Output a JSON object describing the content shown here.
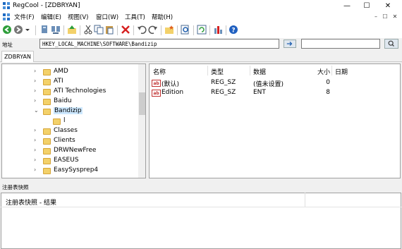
{
  "window": {
    "title": "RegCool - [ZDBRYAN]",
    "minimize": "—",
    "maximize": "☐",
    "close": "✕"
  },
  "menu": {
    "items": [
      "文件(F)",
      "编辑(E)",
      "视图(V)",
      "窗口(W)",
      "工具(T)",
      "帮助(H)"
    ],
    "mdi": [
      "–",
      "☐",
      "✕"
    ]
  },
  "toolbar": {
    "icons": [
      "back-icon",
      "forward-icon",
      "dropdown-icon",
      "computer-icon",
      "network-icon",
      "up-icon",
      "cut-icon",
      "copy-icon",
      "paste-icon",
      "delete-icon",
      "undo-icon",
      "redo-icon",
      "favorites-icon",
      "find-icon",
      "refresh-icon",
      "options-icon",
      "help-icon"
    ]
  },
  "address": {
    "label": "地址",
    "value": "HKEY_LOCAL_MACHINE\\SOFTWARE\\Bandizip",
    "search_value": ""
  },
  "tab": {
    "label": "ZDBRYAN"
  },
  "tree": {
    "items": [
      {
        "label": "AMD",
        "chevron": "›"
      },
      {
        "label": "ATI",
        "chevron": "›"
      },
      {
        "label": "ATI Technologies",
        "chevron": "›"
      },
      {
        "label": "Baidu",
        "chevron": "›"
      },
      {
        "label": "Bandizip",
        "chevron": "⌄"
      },
      {
        "label": "l",
        "chevron": ""
      },
      {
        "label": "Classes",
        "chevron": "›"
      },
      {
        "label": "Clients",
        "chevron": "›"
      },
      {
        "label": "DRWNewFree",
        "chevron": "›"
      },
      {
        "label": "EASEUS",
        "chevron": "›"
      },
      {
        "label": "EasySysprep4",
        "chevron": "›"
      }
    ]
  },
  "list": {
    "columns": [
      "名称",
      "类型",
      "数据",
      "大小",
      "日期"
    ],
    "rows": [
      {
        "name": "(默认)",
        "type": "REG_SZ",
        "data": "(值未设置)",
        "size": "0",
        "date": "",
        "icon": "ab"
      },
      {
        "name": "Edition",
        "type": "REG_SZ",
        "data": "ENT",
        "size": "8",
        "date": "",
        "icon": "ab"
      }
    ]
  },
  "snapshot": {
    "title": "注册表快照",
    "result_label": "注册表快照 - 结果"
  }
}
